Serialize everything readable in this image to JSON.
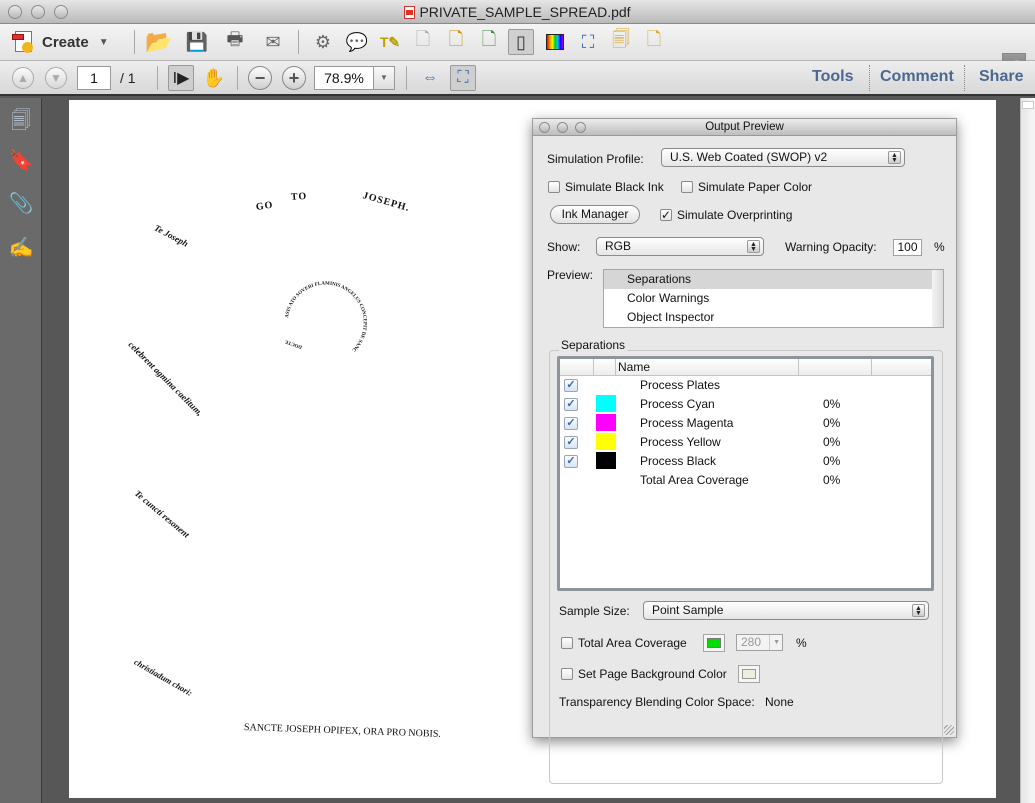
{
  "window": {
    "title": "PRIVATE_SAMPLE_SPREAD.pdf"
  },
  "toolbar": {
    "create_label": "Create",
    "icons": [
      "open-icon",
      "save-icon",
      "print-icon",
      "email-icon",
      "settings-icon",
      "comment-icon",
      "text-edit-icon",
      "delete-doc-icon",
      "export-icon",
      "share-doc-icon",
      "output-preview-icon",
      "color-icon",
      "crop-icon",
      "pages-icon",
      "send-icon"
    ]
  },
  "nav": {
    "page_current": "1",
    "page_total": "/ 1",
    "zoom": "78.9%",
    "tools_label": "Tools",
    "comment_label": "Comment",
    "share_label": "Share"
  },
  "sidebar": {
    "items": [
      "pages-icon",
      "bookmark-icon",
      "attachment-icon",
      "signature-icon"
    ]
  },
  "document": {
    "texts": [
      {
        "text": "GO",
        "style": "caps"
      },
      {
        "text": "TO",
        "style": "caps"
      },
      {
        "text": "JOSEPH.",
        "style": "caps"
      },
      {
        "text": "Te Joseph",
        "style": "italic"
      },
      {
        "text": "ASIS ATO SOVERI FLAMINIS ANGELUS CONCEPIT DE SANCTO",
        "style": "circle"
      },
      {
        "text": "celebrent agmina caelitum,",
        "style": "italic"
      },
      {
        "text": "Te cuncti resonent",
        "style": "italic"
      },
      {
        "text": "christiadum chori:",
        "style": "italic"
      },
      {
        "text": "SANCTE JOSEPH OPIFEX, ORA PRO NOBIS.",
        "style": "caps"
      }
    ]
  },
  "dialog": {
    "title": "Output Preview",
    "simulation_profile_label": "Simulation Profile:",
    "simulation_profile_value": "U.S. Web Coated (SWOP) v2",
    "simulate_black_ink": {
      "label": "Simulate Black Ink",
      "checked": false
    },
    "simulate_paper_color": {
      "label": "Simulate Paper Color",
      "checked": false
    },
    "ink_manager_label": "Ink Manager",
    "simulate_overprinting": {
      "label": "Simulate Overprinting",
      "checked": true
    },
    "show_label": "Show:",
    "show_value": "RGB",
    "warning_opacity_label": "Warning Opacity:",
    "warning_opacity_value": "100",
    "percent": "%",
    "preview_label": "Preview:",
    "preview_items": [
      {
        "label": "Separations",
        "selected": true
      },
      {
        "label": "Color Warnings",
        "selected": false
      },
      {
        "label": "Object Inspector",
        "selected": false
      }
    ],
    "separations_group_label": "Separations",
    "separations_header": {
      "name": "Name"
    },
    "separations": [
      {
        "name": "Process Plates",
        "checked": true,
        "color": null,
        "value": ""
      },
      {
        "name": "Process Cyan",
        "checked": true,
        "color": "#00ffff",
        "value": "0%"
      },
      {
        "name": "Process Magenta",
        "checked": true,
        "color": "#ff00ff",
        "value": "0%"
      },
      {
        "name": "Process Yellow",
        "checked": true,
        "color": "#ffff00",
        "value": "0%"
      },
      {
        "name": "Process Black",
        "checked": true,
        "color": "#000000",
        "value": "0%"
      },
      {
        "name": "Total Area Coverage",
        "checked": false,
        "color": null,
        "value": "0%"
      }
    ],
    "sample_size_label": "Sample Size:",
    "sample_size_value": "Point Sample",
    "total_area_coverage": {
      "label": "Total Area Coverage",
      "checked": false,
      "color": "#00dd00",
      "value": "280",
      "unit": "%"
    },
    "page_background": {
      "label": "Set Page Background Color",
      "checked": false,
      "color": "#efeedd"
    },
    "blending_label": "Transparency Blending Color Space:",
    "blending_value": "None"
  }
}
